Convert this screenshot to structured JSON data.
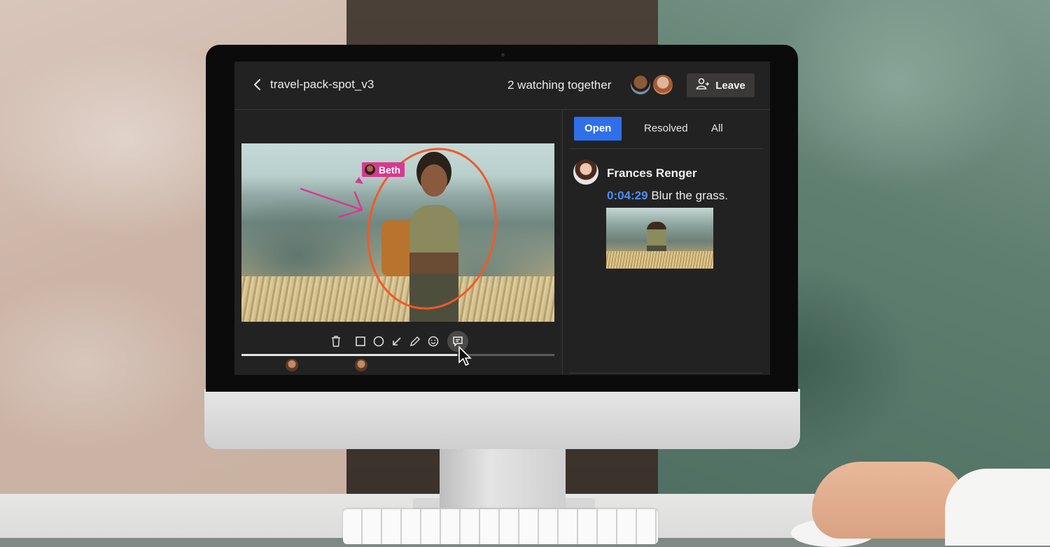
{
  "header": {
    "title": "travel-pack-spot_v3",
    "watching_text": "2 watching together",
    "leave_label": "Leave"
  },
  "viewer": {
    "annotation_user": "Beth",
    "annotation_color": "#d63a8f",
    "circle_color": "#f05a28",
    "progress": 0.69,
    "toolbar_icons": [
      "trash-icon",
      "square-icon",
      "circle-icon",
      "arrow-icon",
      "pen-icon",
      "emoji-icon",
      "comment-icon"
    ],
    "active_tool": "comment-icon"
  },
  "comments_panel": {
    "tabs": [
      {
        "label": "Open",
        "active": true
      },
      {
        "label": "Resolved",
        "active": false
      },
      {
        "label": "All",
        "active": false
      }
    ],
    "accent_color": "#2f6fe9",
    "comments": [
      {
        "author": "Frances Renger",
        "timecode": "0:04:29",
        "text": "Blur the grass."
      }
    ]
  }
}
